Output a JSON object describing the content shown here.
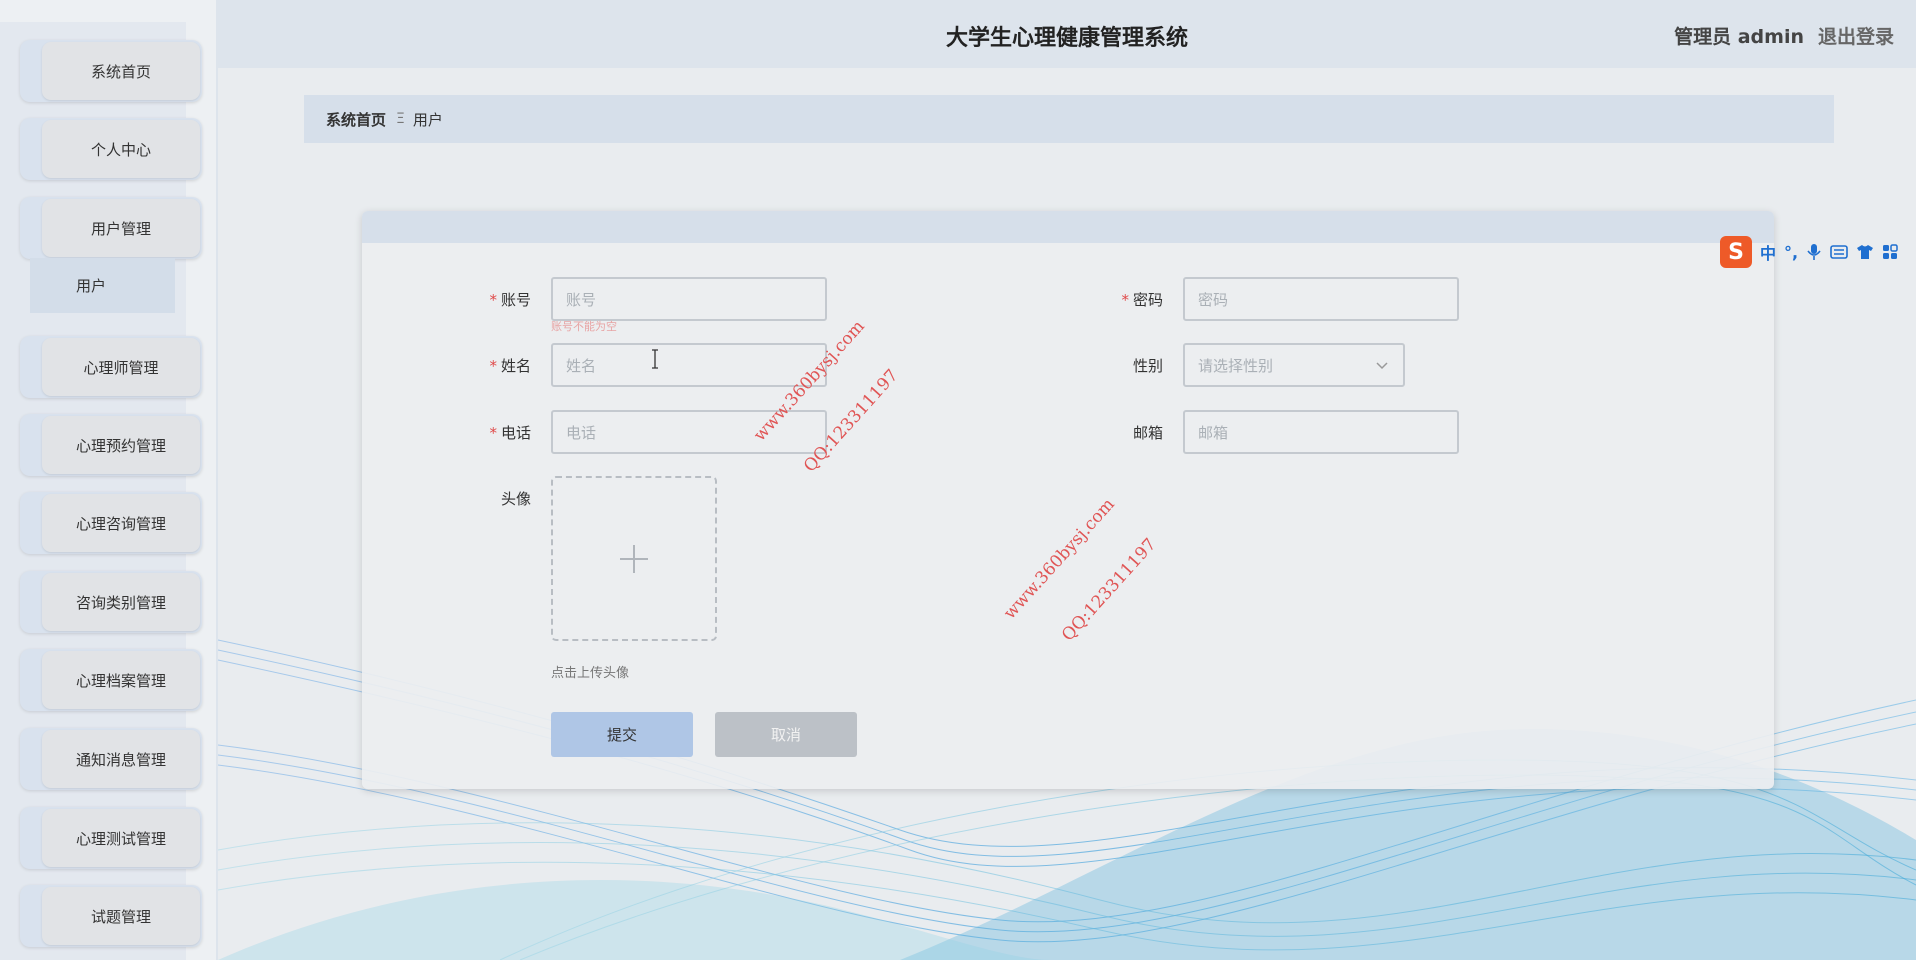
{
  "app": {
    "title": "大学生心理健康管理系统",
    "user_label": "管理员 admin",
    "logout_label": "退出登录"
  },
  "sidebar": {
    "items": [
      {
        "label": "系统首页"
      },
      {
        "label": "个人中心"
      },
      {
        "label": "用户管理"
      },
      {
        "label": "心理师管理"
      },
      {
        "label": "心理预约管理"
      },
      {
        "label": "心理咨询管理"
      },
      {
        "label": "咨询类别管理"
      },
      {
        "label": "心理档案管理"
      },
      {
        "label": "通知消息管理"
      },
      {
        "label": "心理测试管理"
      },
      {
        "label": "试题管理"
      }
    ],
    "submenu": {
      "label": "用户"
    }
  },
  "breadcrumb": {
    "home": "系统首页",
    "separator": "Ξ",
    "current": "用户"
  },
  "form": {
    "account": {
      "label": "账号",
      "placeholder": "账号",
      "required": true,
      "error": "账号不能为空"
    },
    "password": {
      "label": "密码",
      "placeholder": "密码",
      "required": true
    },
    "name": {
      "label": "姓名",
      "placeholder": "姓名",
      "required": true
    },
    "gender": {
      "label": "性别",
      "placeholder": "请选择性别"
    },
    "phone": {
      "label": "电话",
      "placeholder": "电话",
      "required": true
    },
    "email": {
      "label": "邮箱",
      "placeholder": "邮箱"
    },
    "avatar": {
      "label": "头像",
      "tip": "点击上传头像"
    },
    "submit_label": "提交",
    "cancel_label": "取消",
    "required_mark": "*"
  },
  "watermarks": [
    {
      "site": "www.360bysj.com",
      "qq": "QQ:123311197"
    },
    {
      "site": "www.360bysj.com",
      "qq": "QQ:123311197"
    }
  ],
  "ime": {
    "logo": "S",
    "mode": "中",
    "punct": "°,",
    "icons": [
      "microphone-icon",
      "keyboard-icon",
      "skin-icon",
      "toolbox-icon"
    ]
  },
  "colors": {
    "accent": "#afc6e6",
    "required": "#e04a4a",
    "watermark": "#e05555",
    "ime_brand": "#ee5a28"
  }
}
